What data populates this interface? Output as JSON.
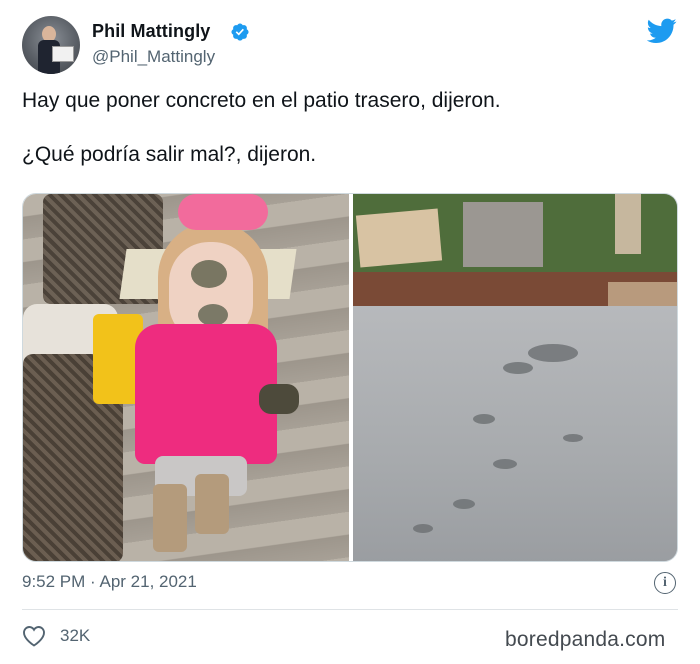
{
  "author": {
    "name": "Phil Mattingly",
    "handle": "@Phil_Mattingly",
    "verified": true
  },
  "tweet": {
    "lines": [
      "Hay que poner concreto en el patio trasero, dijeron.",
      "¿Qué podría salir mal?, dijeron."
    ],
    "timestamp": "9:52 PM · Apr 21, 2021",
    "likes": "32K"
  },
  "icons": {
    "brand": "twitter-bird-icon",
    "verified": "verified-badge-icon",
    "info": "info-icon",
    "like": "heart-icon"
  },
  "watermark": "boredpanda.com",
  "colors": {
    "twitter_blue": "#1d9bf0",
    "secondary_text": "#536471",
    "primary_text": "#0f1419"
  }
}
